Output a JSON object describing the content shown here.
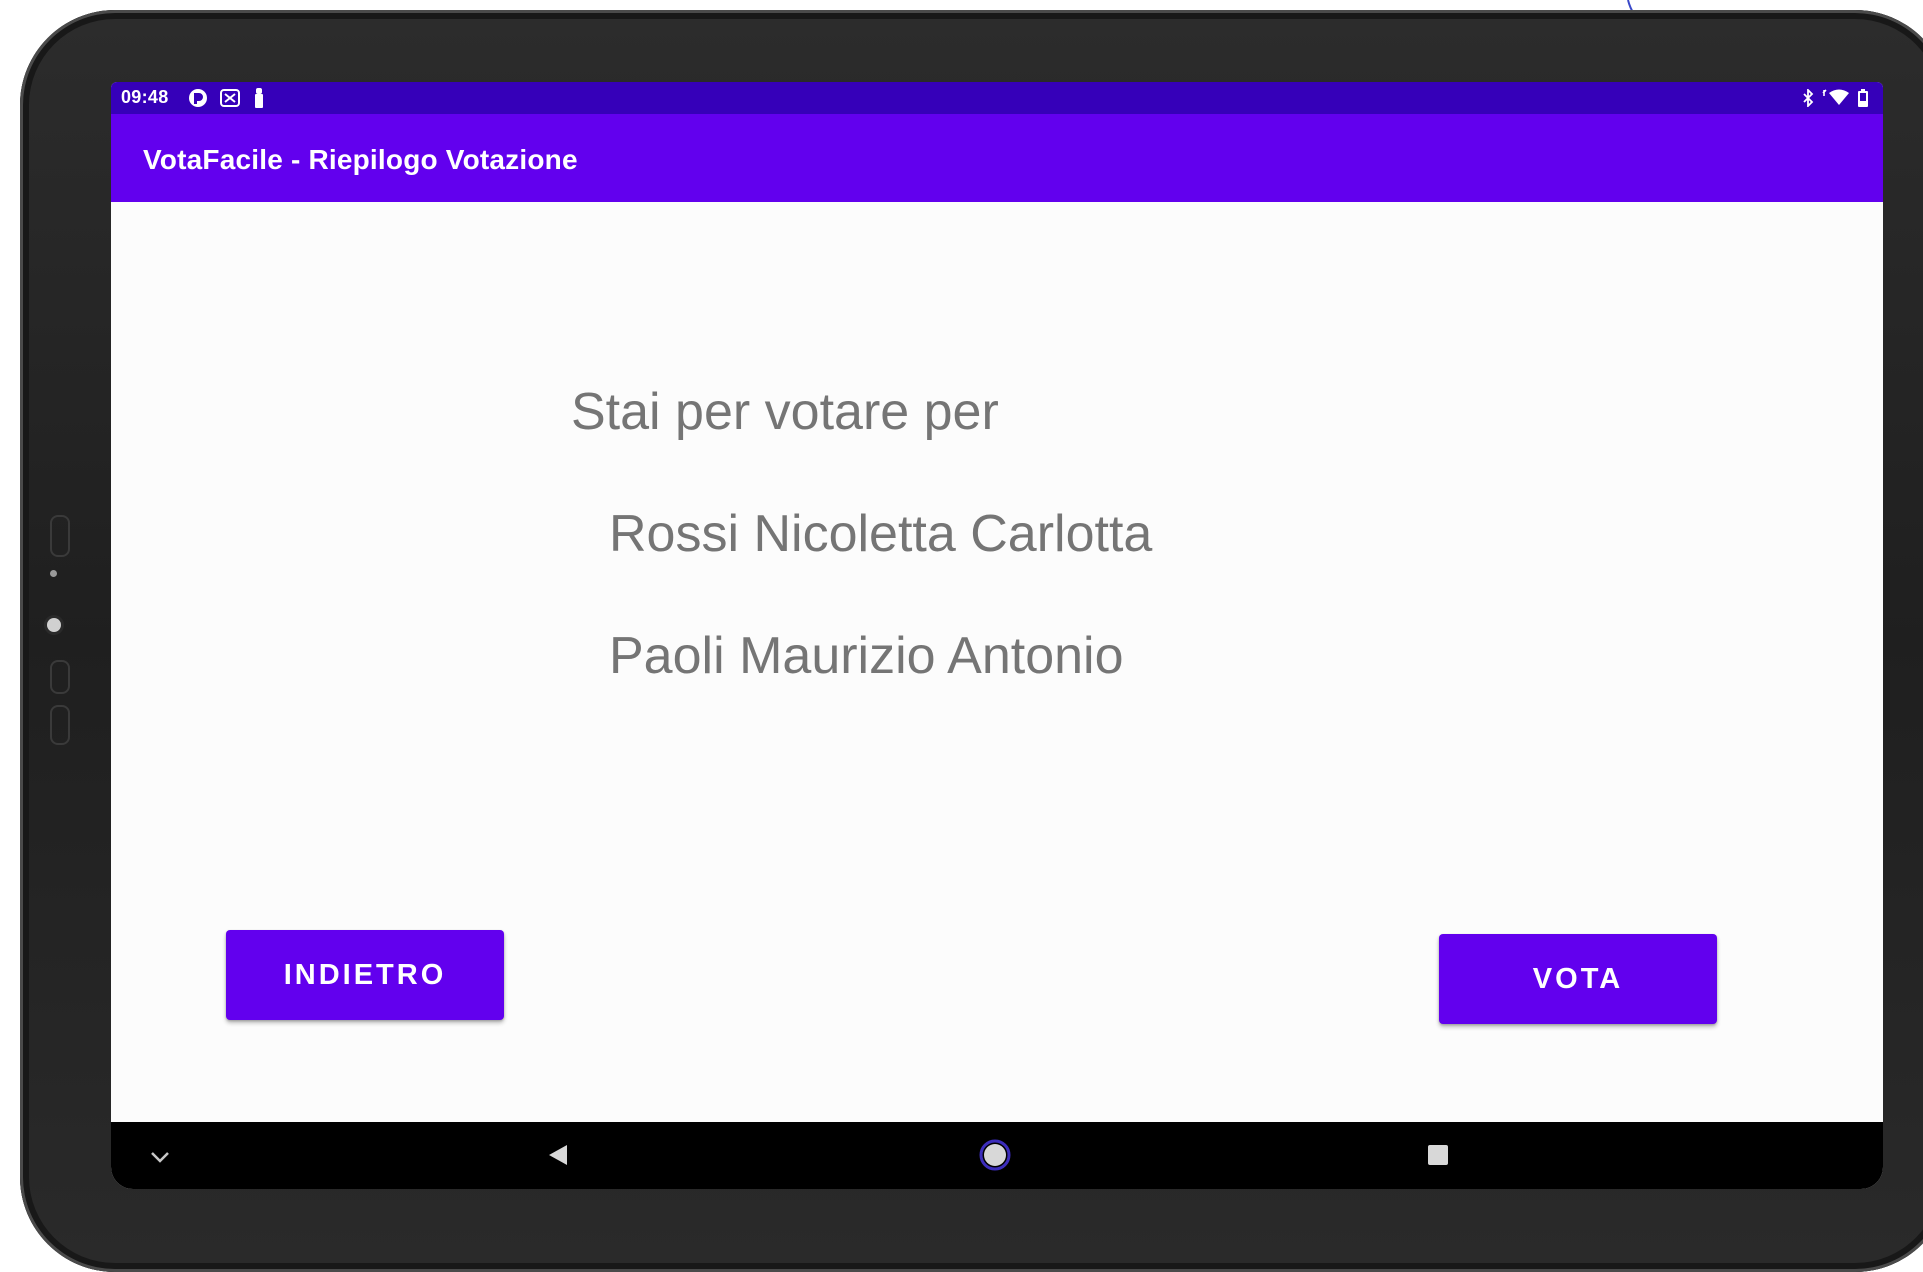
{
  "status_bar": {
    "time": "09:48",
    "left_icons": [
      "app-notification-icon",
      "wireless-debug-icon",
      "tool-icon"
    ],
    "right_icons": [
      "bluetooth-icon",
      "wifi-icon",
      "battery-icon"
    ]
  },
  "app_bar": {
    "title": "VotaFacile - Riepilogo Votazione"
  },
  "summary": {
    "headline": "Stai per votare per",
    "candidates": [
      "Rossi Nicoletta Carlotta",
      "Paoli Maurizio Antonio"
    ]
  },
  "actions": {
    "back_label": "INDIETRO",
    "vote_label": "VOTA"
  },
  "nav_bar": {
    "icons": [
      "chevron-down-icon",
      "back-icon",
      "home-icon",
      "recents-icon"
    ]
  },
  "colors": {
    "primary": "#6200ee",
    "primary_dark": "#3600b9",
    "text_secondary": "#757575",
    "background": "#fcfcfc"
  }
}
